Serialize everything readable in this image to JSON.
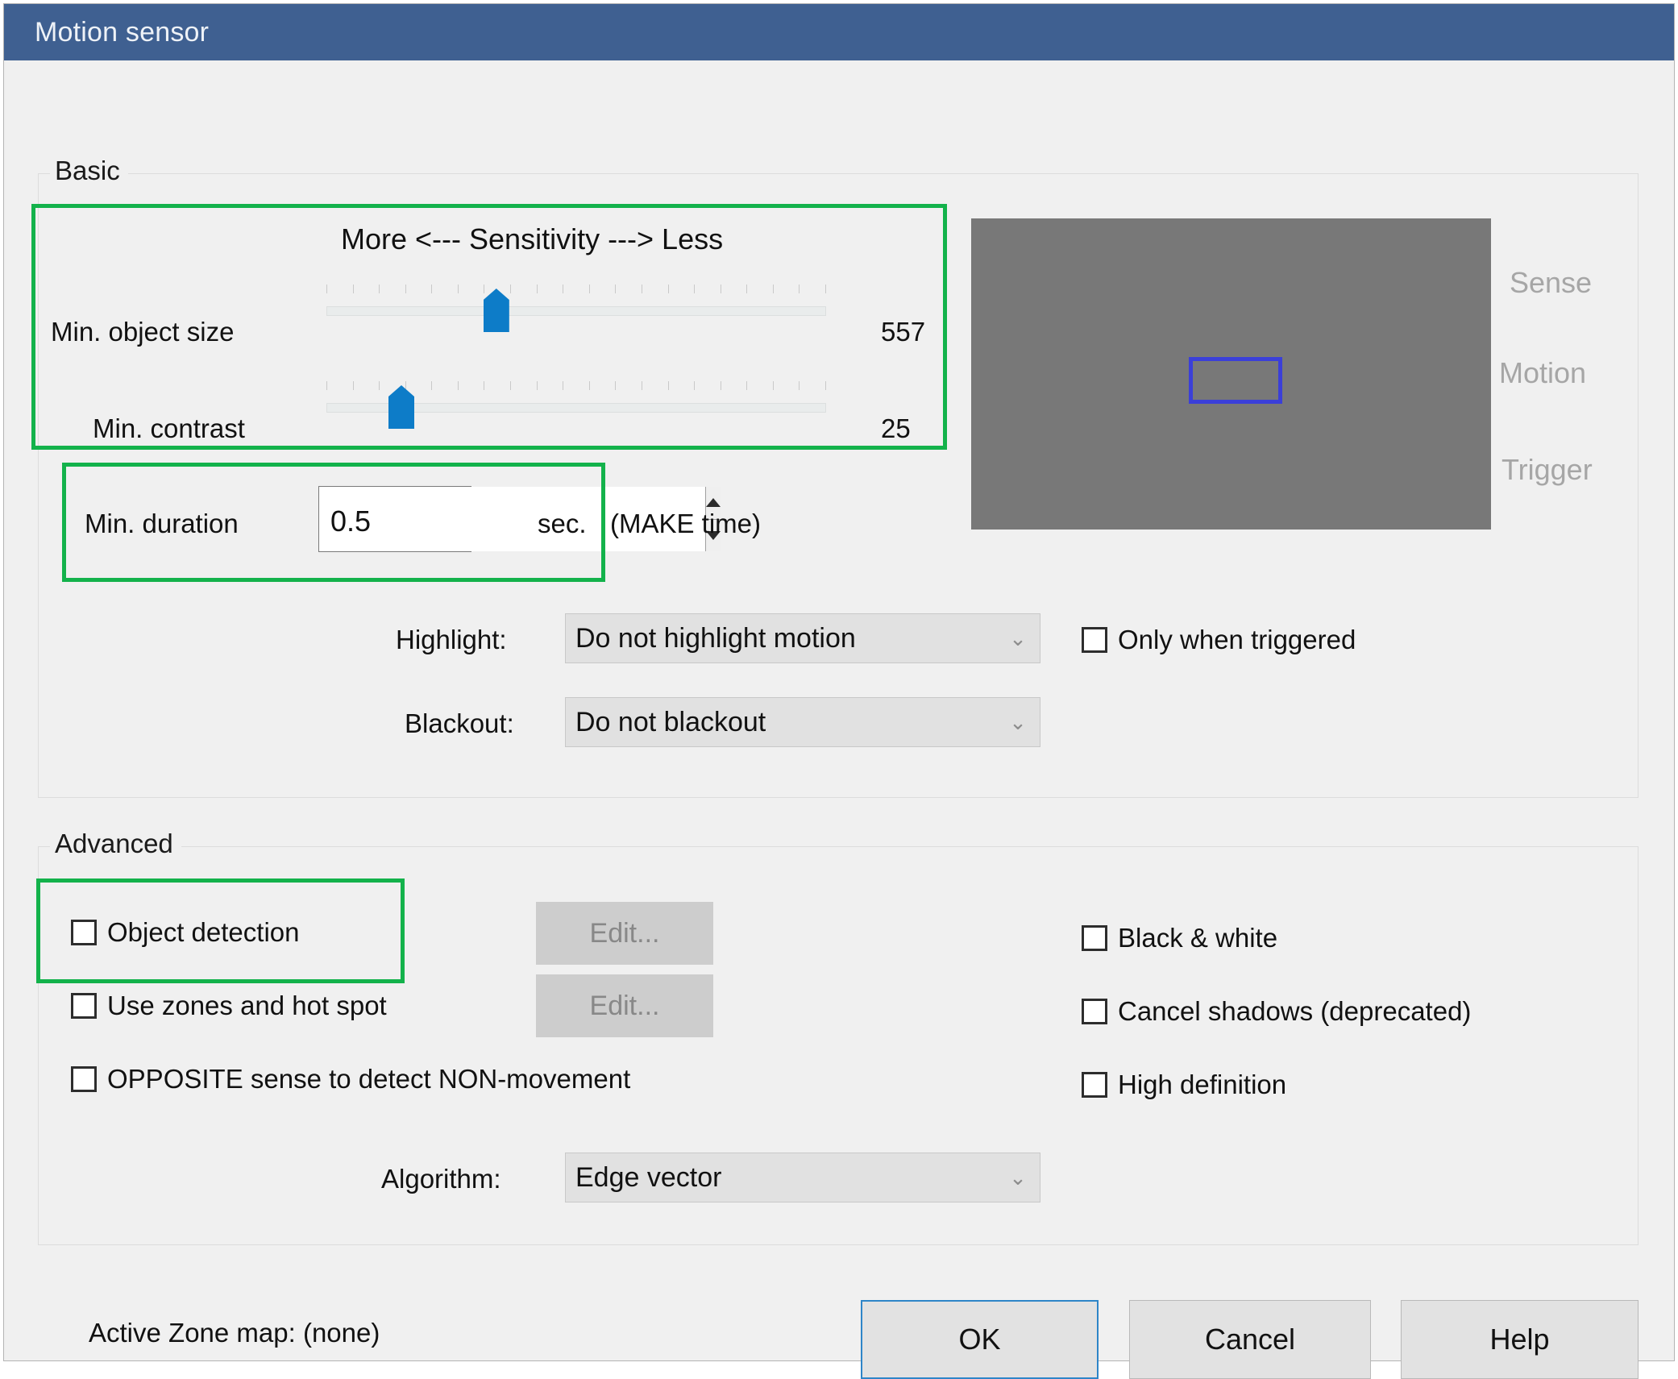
{
  "window": {
    "title": "Motion sensor"
  },
  "basic": {
    "legend": "Basic",
    "sensitivity_caption": "More <--- Sensitivity ---> Less",
    "min_object_size_label": "Min. object size",
    "min_object_size_value": "557",
    "min_contrast_label": "Min. contrast",
    "min_contrast_value": "25",
    "min_duration_label": "Min. duration",
    "min_duration_value": "0.5",
    "min_duration_unit": "sec.",
    "min_duration_note": "(MAKE time)",
    "highlight_label": "Highlight:",
    "highlight_value": "Do not highlight motion",
    "blackout_label": "Blackout:",
    "blackout_value": "Do not blackout",
    "only_when_triggered_label": "Only when triggered",
    "chevron": "⌄"
  },
  "preview": {
    "sense_label": "Sense",
    "motion_label": "Motion",
    "trigger_label": "Trigger",
    "background_color": "#787878",
    "motion_box_color": "#3b3fd8"
  },
  "advanced": {
    "legend": "Advanced",
    "object_detection_label": "Object detection",
    "use_zones_label": "Use zones and hot spot",
    "opposite_sense_label": "OPPOSITE sense to detect NON-movement",
    "black_white_label": "Black & white",
    "cancel_shadows_label": "Cancel shadows (deprecated)",
    "high_definition_label": "High definition",
    "edit_object_detection_label": "Edit...",
    "edit_zones_label": "Edit...",
    "algorithm_label": "Algorithm:",
    "algorithm_value": "Edge vector",
    "chevron": "⌄"
  },
  "footer": {
    "active_zone_map_label": "Active Zone map:  (none)",
    "ok_label": "OK",
    "cancel_label": "Cancel",
    "help_label": "Help"
  },
  "annotations": {
    "color": "#13b24b"
  },
  "sliders": {
    "min_object_size_percent": 34,
    "min_contrast_percent": 15
  }
}
